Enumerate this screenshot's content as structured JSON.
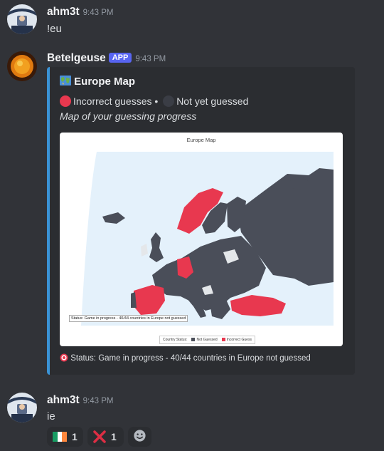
{
  "messages": [
    {
      "username": "ahm3t",
      "timestamp": "9:43 PM",
      "text": "!eu"
    },
    {
      "username": "Betelgeuse",
      "badge": "APP",
      "timestamp": "9:43 PM"
    },
    {
      "username": "ahm3t",
      "timestamp": "9:43 PM",
      "text": "ie"
    }
  ],
  "embed": {
    "title": "Europe Map",
    "title_icon": "world-map-icon",
    "legend_incorrect": "Incorrect guesses •",
    "legend_not_guessed": "Not yet guessed",
    "subtitle": "Map of your guessing progress",
    "image": {
      "title": "Europe Map",
      "status": "Status: Game in progress - 40/44 countries in Europe not guessed",
      "legend_title": "Country Status:",
      "legend_not_guessed": "Not Guessed",
      "legend_incorrect": "Incorrect Guess"
    },
    "footer": "Status: Game in progress - 40/44 countries in Europe not guessed",
    "footer_icon": "target-icon"
  },
  "reactions": [
    {
      "icon": "ireland-flag-icon",
      "count": "1"
    },
    {
      "icon": "red-x-icon",
      "count": "1"
    },
    {
      "icon": "add-reaction-icon"
    }
  ],
  "colors": {
    "background": "#313338",
    "embed_bg": "#2b2d31",
    "embed_border": "#3a93d6",
    "incorrect": "#e8384f",
    "not_guessed": "#4a4e59",
    "app_badge": "#5865f2"
  }
}
